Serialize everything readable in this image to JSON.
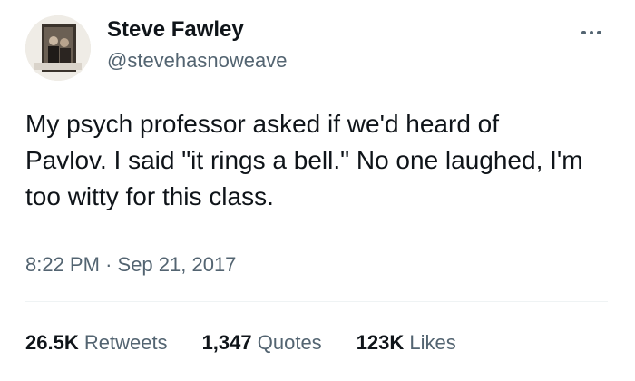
{
  "user": {
    "display_name": "Steve Fawley",
    "handle": "@stevehasnoweave"
  },
  "tweet": {
    "lines": [
      "My psych professor asked if we'd heard of",
      "Pavlov. I said \"it rings a bell.\" No one laughed, I'm",
      "too witty for this class."
    ],
    "time": "8:22 PM",
    "separator": "·",
    "date": "Sep 21, 2017"
  },
  "stats": {
    "retweets": {
      "count": "26.5K",
      "label": "Retweets"
    },
    "quotes": {
      "count": "1,347",
      "label": "Quotes"
    },
    "likes": {
      "count": "123K",
      "label": "Likes"
    }
  },
  "icons": {
    "more": "more-horizontal-icon"
  },
  "colors": {
    "text_primary": "#0f1419",
    "text_secondary": "#536471",
    "divider": "#eff3f4",
    "background": "#ffffff"
  }
}
